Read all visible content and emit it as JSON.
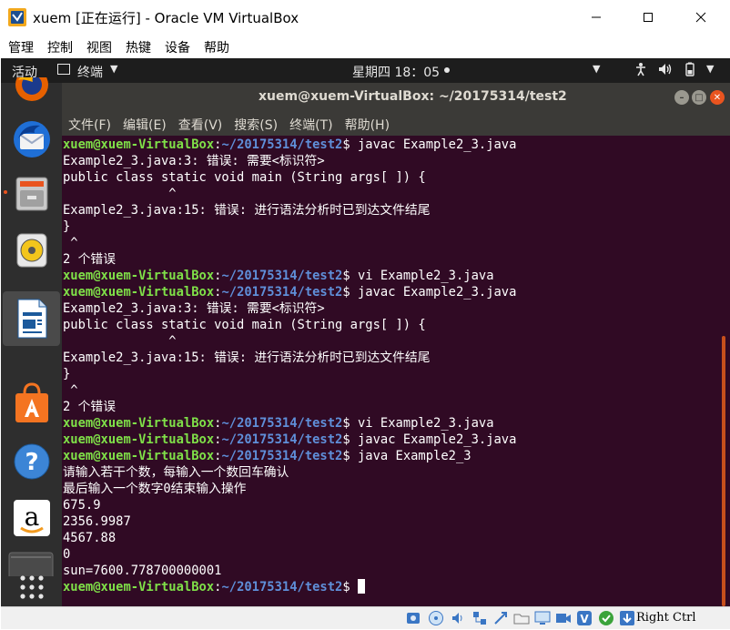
{
  "window": {
    "title": "xuem [正在运行] - Oracle VM VirtualBox",
    "controls": {
      "minimize": "—",
      "maximize": "☐",
      "close": "✕"
    }
  },
  "vbox_menu": [
    "管理",
    "控制",
    "视图",
    "热键",
    "设备",
    "帮助"
  ],
  "topbar": {
    "activities": "活动",
    "app_label": "终端",
    "clock": "星期四 18：05",
    "dropdown_glyph": "▼",
    "tray_icons": [
      "accessibility-icon",
      "sound-icon",
      "power-icon"
    ]
  },
  "dock": {
    "items": [
      "firefox-icon",
      "thunderbird-icon",
      "files-icon",
      "rhythmbox-icon",
      "libreoffice-writer-icon",
      "software-center-icon",
      "help-icon",
      "amazon-icon",
      "terminal-icon",
      "show-apps-icon"
    ]
  },
  "terminal": {
    "title": "xuem@xuem-VirtualBox: ~/20175314/test2",
    "menu": [
      "文件(F)",
      "编辑(E)",
      "查看(V)",
      "搜索(S)",
      "终端(T)",
      "帮助(H)"
    ],
    "lines": [
      {
        "user": "xuem@xuem-VirtualBox",
        "path": "~/20175314/test2",
        "cmd": "javac Example2_3.java"
      },
      {
        "text": "Example2_3.java:3: 错误: 需要<标识符>"
      },
      {
        "text": "public class static void main (String args[ ]) {"
      },
      {
        "text": "              ^"
      },
      {
        "text": "Example2_3.java:15: 错误: 进行语法分析时已到达文件结尾"
      },
      {
        "text": "}"
      },
      {
        "text": " ^"
      },
      {
        "text": "2 个错误"
      },
      {
        "user": "xuem@xuem-VirtualBox",
        "path": "~/20175314/test2",
        "cmd": "vi Example2_3.java"
      },
      {
        "user": "xuem@xuem-VirtualBox",
        "path": "~/20175314/test2",
        "cmd": "javac Example2_3.java"
      },
      {
        "text": "Example2_3.java:3: 错误: 需要<标识符>"
      },
      {
        "text": "public class static void main (String args[ ]) {"
      },
      {
        "text": "              ^"
      },
      {
        "text": "Example2_3.java:15: 错误: 进行语法分析时已到达文件结尾"
      },
      {
        "text": "}"
      },
      {
        "text": " ^"
      },
      {
        "text": "2 个错误"
      },
      {
        "user": "xuem@xuem-VirtualBox",
        "path": "~/20175314/test2",
        "cmd": "vi Example2_3.java"
      },
      {
        "user": "xuem@xuem-VirtualBox",
        "path": "~/20175314/test2",
        "cmd": "javac Example2_3.java"
      },
      {
        "user": "xuem@xuem-VirtualBox",
        "path": "~/20175314/test2",
        "cmd": "java Example2_3"
      },
      {
        "text": "请输入若干个数，每输入一个数回车确认"
      },
      {
        "text": "最后输入一个数字0结束输入操作"
      },
      {
        "text": "675.9"
      },
      {
        "text": "2356.9987"
      },
      {
        "text": "4567.88"
      },
      {
        "text": "0"
      },
      {
        "text": "sun=7600.778700000001"
      },
      {
        "user": "xuem@xuem-VirtualBox",
        "path": "~/20175314/test2",
        "cmd": "",
        "cursor": true
      }
    ],
    "colors": {
      "background": "#300a24",
      "prompt_user": "#7fe048",
      "prompt_path": "#5f8fd9",
      "text": "#ffffff"
    }
  },
  "statusbar": {
    "icons": [
      "hard-disk-icon",
      "optical-drive-icon",
      "audio-icon",
      "network-icon",
      "usb-icon",
      "shared-folder-icon",
      "display-icon",
      "video-capture-icon",
      "virtualization-icon",
      "mouse-integration-icon",
      "keyboard-capture-icon"
    ],
    "host_key": "Right Ctrl"
  }
}
